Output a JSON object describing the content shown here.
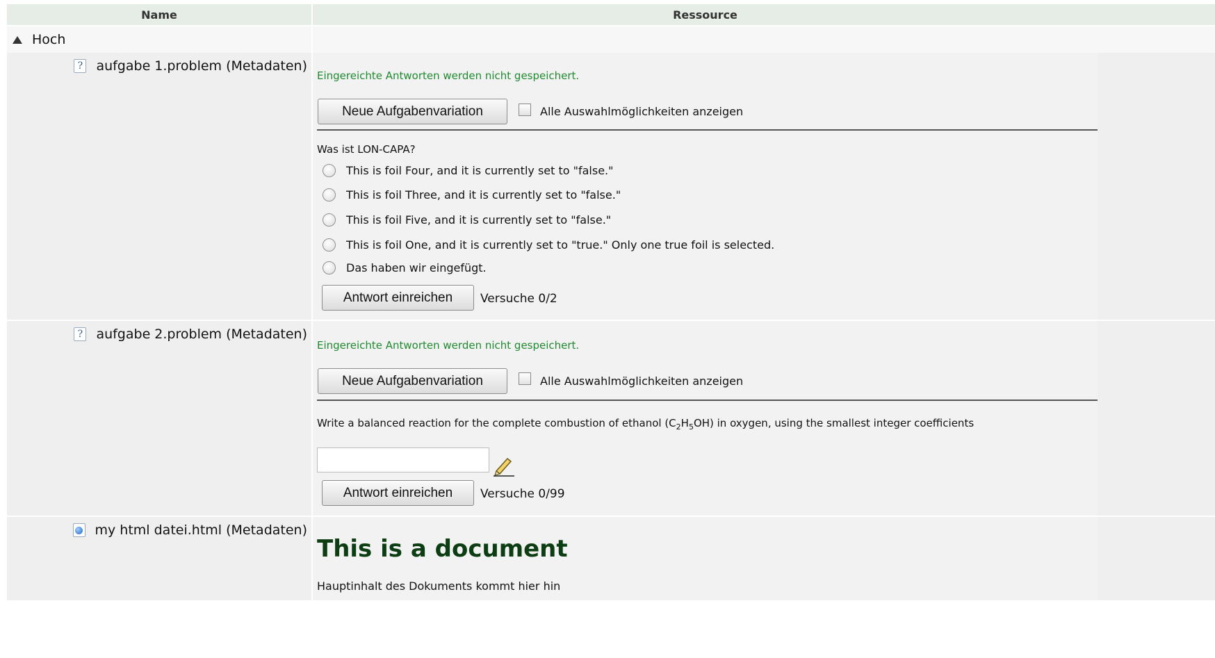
{
  "header": {
    "name": "Name",
    "resource": "Ressource"
  },
  "folder": {
    "label": "Hoch",
    "icon": "triangle-up-icon"
  },
  "resources": [
    {
      "name": "aufgabe 1.problem",
      "metadata": "(Metadaten)",
      "icon": "problem-icon",
      "saved_note": "Eingereichte Antworten werden nicht gespeichert.",
      "new_variation": "Neue Aufgabenvariation",
      "show_all": "Alle Auswahlmöglichkeiten anzeigen",
      "question": "Was ist LON-CAPA?",
      "foils": [
        "This is foil Four, and it is currently set to \"false.\"",
        "This is foil Three, and it is currently set to \"false.\"",
        "This is foil Five, and it is currently set to \"false.\"",
        "This is foil One, and it is currently set to \"true.\" Only one true foil is selected.",
        "Das haben wir eingefügt."
      ],
      "submit": "Antwort einreichen",
      "tries": "Versuche 0/2"
    },
    {
      "name": "aufgabe 2.problem",
      "metadata": "(Metadaten)",
      "icon": "problem-icon",
      "saved_note": "Eingereichte Antworten werden nicht gespeichert.",
      "new_variation": "Neue Aufgabenvariation",
      "show_all": "Alle Auswahlmöglichkeiten anzeigen",
      "question_prefix": "Write a balanced reaction for the complete combustion of ethanol (C",
      "sub1": "2",
      "mid1": "H",
      "sub2": "5",
      "question_suffix": "OH) in oxygen, using the smallest integer coefficients",
      "answer_value": "",
      "editor_icon": "pencil-icon",
      "submit": "Antwort einreichen",
      "tries": "Versuche 0/99"
    },
    {
      "name": "my html datei.html",
      "metadata": "(Metadaten)",
      "icon": "web-page-icon",
      "doc_title": "This is a document",
      "doc_body": "Hauptinhalt des Dokuments kommt hier hin"
    }
  ],
  "colors": {
    "header_bg": "#e6ece6",
    "row_bg": "#efefef",
    "note_green": "#1f8a2f",
    "doc_title": "#0d3d12"
  }
}
